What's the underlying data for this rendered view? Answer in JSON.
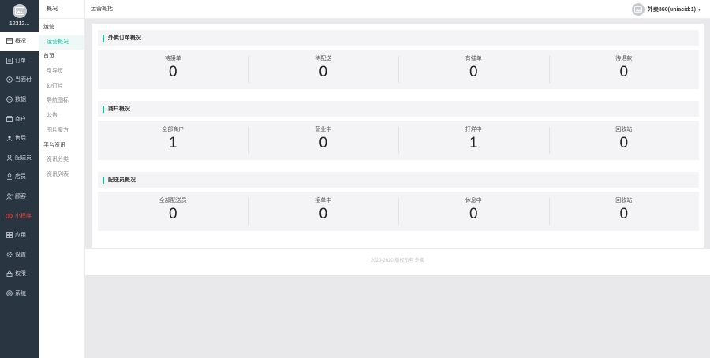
{
  "sidebar": {
    "username": "12312...",
    "items": [
      {
        "label": "概况",
        "icon": "home-icon",
        "active": true
      },
      {
        "label": "订单",
        "icon": "order-icon"
      },
      {
        "label": "当面付",
        "icon": "pay-icon"
      },
      {
        "label": "数据",
        "icon": "data-icon"
      },
      {
        "label": "商户",
        "icon": "store-icon"
      },
      {
        "label": "售后",
        "icon": "service-icon"
      },
      {
        "label": "配送员",
        "icon": "courier-icon"
      },
      {
        "label": "店员",
        "icon": "clerk-icon"
      },
      {
        "label": "顾客",
        "icon": "customer-icon"
      },
      {
        "label": "小程序",
        "icon": "miniprogram-icon",
        "red": true
      },
      {
        "label": "应用",
        "icon": "apps-icon"
      },
      {
        "label": "设置",
        "icon": "gear-icon"
      },
      {
        "label": "权限",
        "icon": "lock-icon"
      },
      {
        "label": "系统",
        "icon": "system-icon"
      }
    ]
  },
  "subnav": {
    "title": "概况",
    "groups": [
      {
        "label": "运营",
        "items": [
          {
            "label": "运营概况",
            "active": true
          }
        ]
      },
      {
        "label": "首页",
        "items": [
          {
            "label": "引导页"
          },
          {
            "label": "幻灯片"
          },
          {
            "label": "导航图标"
          },
          {
            "label": "公告"
          },
          {
            "label": "图片魔方"
          }
        ]
      },
      {
        "label": "平台资讯",
        "items": [
          {
            "label": "资讯分类"
          },
          {
            "label": "资讯列表"
          }
        ]
      }
    ]
  },
  "topbar": {
    "breadcrumb": "运营概括",
    "account_name": "外卖360(uniacid:1)",
    "caret": "▾"
  },
  "sections": [
    {
      "title": "外卖订单概况",
      "stats": [
        {
          "label": "待接单",
          "value": "0"
        },
        {
          "label": "待配送",
          "value": "0"
        },
        {
          "label": "有催单",
          "value": "0"
        },
        {
          "label": "待退款",
          "value": "0"
        }
      ]
    },
    {
      "title": "商户概况",
      "stats": [
        {
          "label": "全部商户",
          "value": "1"
        },
        {
          "label": "营业中",
          "value": "0"
        },
        {
          "label": "打烊中",
          "value": "1"
        },
        {
          "label": "回收站",
          "value": "0"
        }
      ]
    },
    {
      "title": "配送员概况",
      "stats": [
        {
          "label": "全部配送员",
          "value": "0"
        },
        {
          "label": "接单中",
          "value": "0"
        },
        {
          "label": "休息中",
          "value": "0"
        },
        {
          "label": "回收站",
          "value": "0"
        }
      ]
    }
  ],
  "footer": {
    "text": "2020-2020 版权所有 外卖"
  },
  "colors": {
    "accent": "#1abc9c",
    "sidebar_bg": "#2a3542",
    "danger": "#e0443e"
  }
}
